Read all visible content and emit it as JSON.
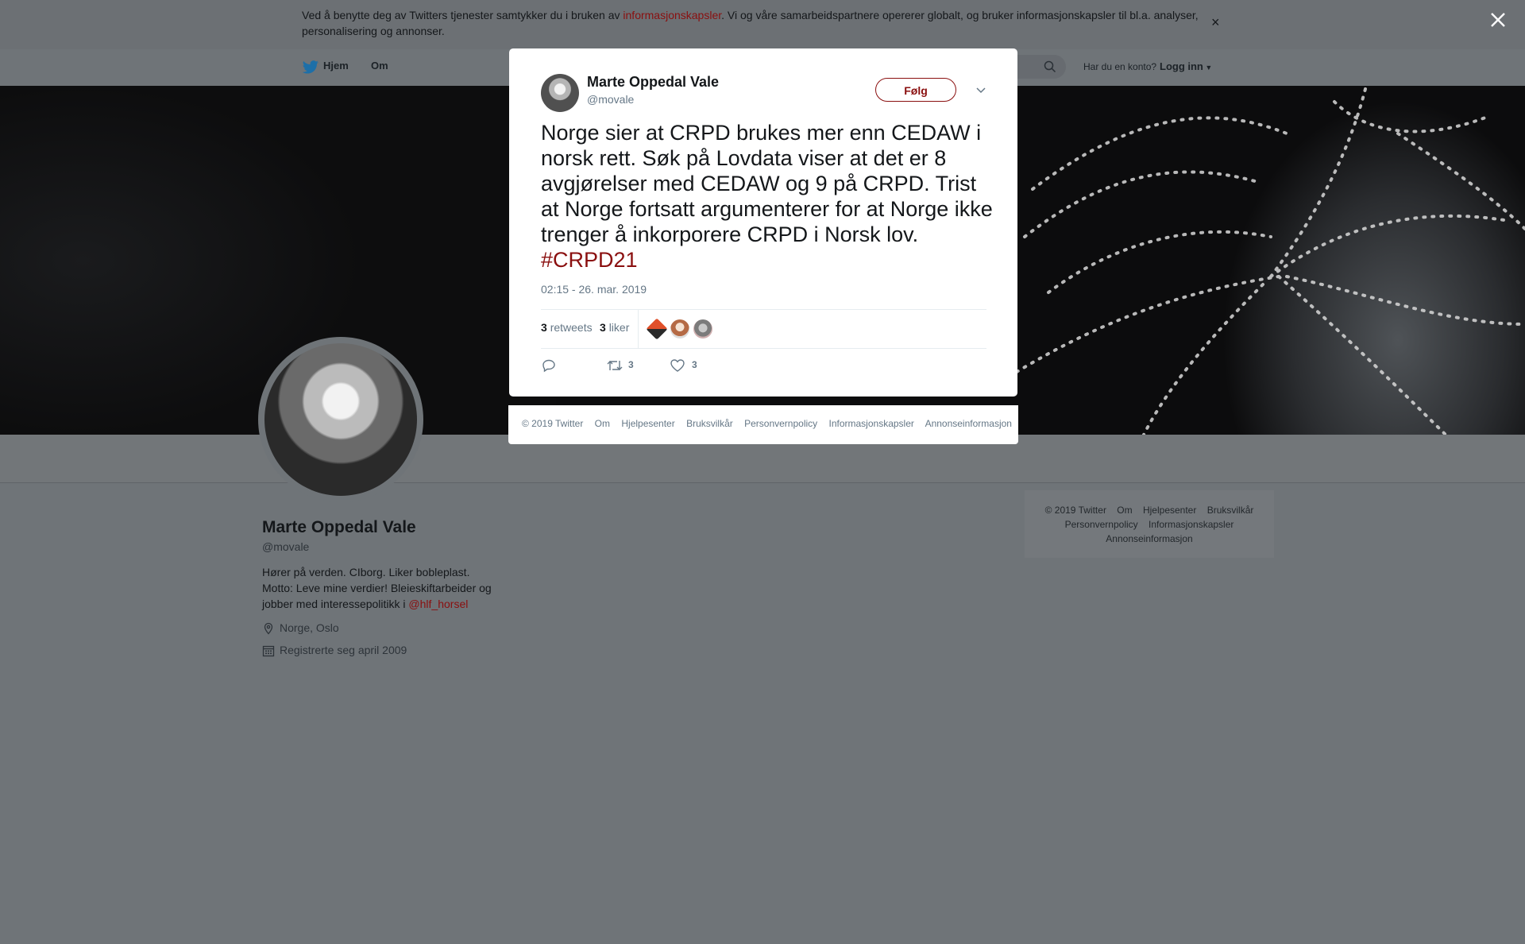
{
  "cookie_banner": {
    "text_before": "Ved å benytte deg av Twitters tjenester samtykker du i bruken av ",
    "link": "informasjonskapsler",
    "text_after": ". Vi og våre samarbeidspartnere opererer globalt, og bruker informasjonskapsler til bl.a. analyser, personalisering og annonser.",
    "close": "×"
  },
  "nav": {
    "home": "Hjem",
    "about": "Om",
    "account_question": "Har du en konto?",
    "login": "Logg inn"
  },
  "profile": {
    "name": "Marte Oppedal Vale",
    "handle": "@movale",
    "bio_text": "Hører på verden. CIborg. Liker bobleplast. Motto: Leve mine verdier! Bleieskiftarbeider og jobber med interessepolitikk i ",
    "bio_link": "@hlf_horsel",
    "location": "Norge, Oslo",
    "joined": "Registrerte seg april 2009"
  },
  "side_footer": {
    "row1": [
      "© 2019 Twitter",
      "Om",
      "Hjelpesenter",
      "Bruksvilkår"
    ],
    "row2": [
      "Personvernpolicy",
      "Informasjonskapsler"
    ],
    "row3": [
      "Annonseinformasjon"
    ]
  },
  "tweet": {
    "name": "Marte Oppedal Vale",
    "handle": "@movale",
    "follow": "Følg",
    "text": "Norge sier at CRPD brukes mer enn CEDAW i norsk rett. Søk på Lovdata viser at det er 8 avgjørelser med CEDAW og 9 på CRPD. Trist at Norge fortsatt argumenterer for at Norge ikke trenger å inkorporere CRPD i Norsk lov. ",
    "hashtag": "#CRPD21",
    "timestamp": "02:15 - 26. mar. 2019",
    "retweets_count": "3",
    "retweets_label": "retweets",
    "likes_count": "3",
    "likes_label": "liker",
    "action_retweet_count": "3",
    "action_like_count": "3"
  },
  "modal_footer": [
    "© 2019 Twitter",
    "Om",
    "Hjelpesenter",
    "Bruksvilkår",
    "Personvernpolicy",
    "Informasjonskapsler",
    "Annonseinformasjon"
  ],
  "colors": {
    "link": "#8a0f0f",
    "overlay": "#6f7478",
    "muted": "#657786"
  },
  "icons": [
    "twitter-bird-icon",
    "search-icon",
    "close-icon",
    "location-icon",
    "calendar-icon",
    "chevron-down-icon",
    "reply-icon",
    "retweet-icon",
    "heart-icon"
  ]
}
